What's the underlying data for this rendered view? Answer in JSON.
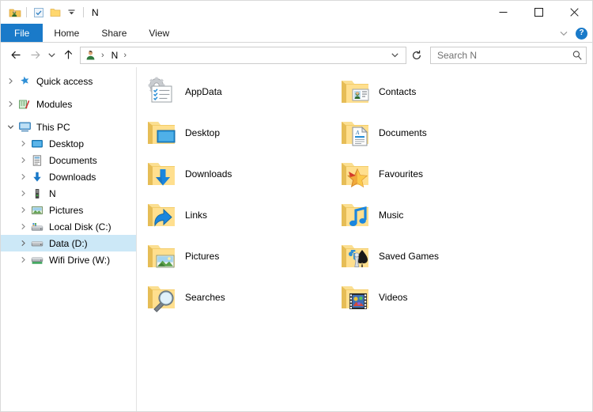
{
  "window": {
    "title": "N",
    "quick_access_toolbar": [
      {
        "name": "user-folder-icon",
        "label": "Properties"
      },
      {
        "name": "properties-checkbox-icon",
        "label": "Properties"
      },
      {
        "name": "new-folder-icon",
        "label": "New folder"
      },
      {
        "name": "customize-qat-chevron-icon",
        "label": "Customize Quick Access Toolbar"
      }
    ],
    "controls": {
      "minimize": "─",
      "maximize": "□",
      "close": "✕"
    }
  },
  "ribbon": {
    "tabs": [
      {
        "id": "file",
        "label": "File",
        "active": true
      },
      {
        "id": "home",
        "label": "Home",
        "active": false
      },
      {
        "id": "share",
        "label": "Share",
        "active": false
      },
      {
        "id": "view",
        "label": "View",
        "active": false
      }
    ],
    "collapse_label": "Minimize the Ribbon",
    "help_label": "?"
  },
  "address": {
    "back_label": "Back",
    "forward_label": "Forward",
    "recent_label": "Recent locations",
    "up_label": "Up to This PC",
    "crumb_icon": "user-account-icon",
    "crumb_text": "N",
    "crumb_sep": "›",
    "dropdown_label": "Previous locations",
    "refresh_label": "Refresh",
    "search_placeholder": "Search N",
    "search_value": ""
  },
  "sidebar": {
    "items": [
      {
        "label": "Quick access",
        "icon": "star-icon",
        "level": 0,
        "expanded": false,
        "selected": false,
        "has_chevron": true
      },
      {
        "label": "Modules",
        "icon": "modules-icon",
        "level": 0,
        "expanded": false,
        "selected": false,
        "has_chevron": true
      },
      {
        "label": "This PC",
        "icon": "monitor-icon",
        "level": 0,
        "expanded": true,
        "selected": false,
        "has_chevron": true
      },
      {
        "label": "Desktop",
        "icon": "desktop-icon",
        "level": 1,
        "expanded": false,
        "selected": false,
        "has_chevron": true
      },
      {
        "label": "Documents",
        "icon": "documents-icon",
        "level": 1,
        "expanded": false,
        "selected": false,
        "has_chevron": true
      },
      {
        "label": "Downloads",
        "icon": "downloads-icon",
        "level": 1,
        "expanded": false,
        "selected": false,
        "has_chevron": true
      },
      {
        "label": "N",
        "icon": "usb-drive-icon",
        "level": 1,
        "expanded": false,
        "selected": false,
        "has_chevron": true
      },
      {
        "label": "Pictures",
        "icon": "pictures-icon",
        "level": 1,
        "expanded": false,
        "selected": false,
        "has_chevron": true
      },
      {
        "label": "Local Disk (C:)",
        "icon": "system-drive-icon",
        "level": 1,
        "expanded": false,
        "selected": false,
        "has_chevron": true
      },
      {
        "label": "Data (D:)",
        "icon": "hard-drive-icon",
        "level": 1,
        "expanded": false,
        "selected": true,
        "has_chevron": true
      },
      {
        "label": "Wifi Drive (W:)",
        "icon": "network-drive-icon",
        "level": 1,
        "expanded": false,
        "selected": false,
        "has_chevron": true
      }
    ]
  },
  "content": {
    "view_mode": "medium-icons",
    "items": [
      {
        "label": "AppData",
        "icon": "appdata-gear-checklist-icon"
      },
      {
        "label": "Contacts",
        "icon": "folder-contacts-icon"
      },
      {
        "label": "Desktop",
        "icon": "folder-desktop-icon"
      },
      {
        "label": "Documents",
        "icon": "folder-documents-icon"
      },
      {
        "label": "Downloads",
        "icon": "folder-downloads-icon"
      },
      {
        "label": "Favourites",
        "icon": "folder-favourites-icon"
      },
      {
        "label": "Links",
        "icon": "folder-links-icon"
      },
      {
        "label": "Music",
        "icon": "folder-music-icon"
      },
      {
        "label": "Pictures",
        "icon": "folder-pictures-icon"
      },
      {
        "label": "Saved Games",
        "icon": "folder-saved-games-icon"
      },
      {
        "label": "Searches",
        "icon": "folder-searches-icon"
      },
      {
        "label": "Videos",
        "icon": "folder-videos-icon"
      }
    ]
  },
  "colors": {
    "accent_blue": "#1a7ac9",
    "selection_blue": "#cce8f7",
    "hover_blue": "#e5f3fb",
    "folder_yellow": "#ffd76e",
    "folder_yellow_dark": "#f0bf55",
    "border_grey": "#d6d6d6"
  }
}
